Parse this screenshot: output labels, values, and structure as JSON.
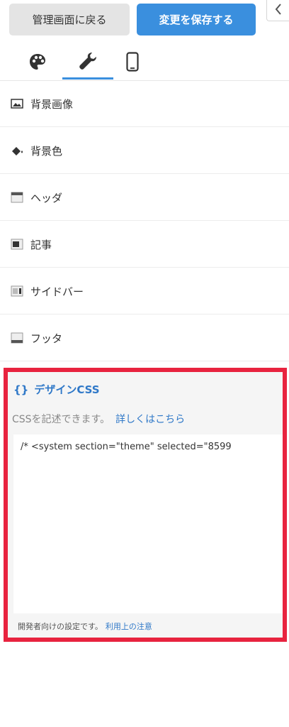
{
  "toolbar": {
    "back_label": "管理画面に戻る",
    "save_label": "変更を保存する"
  },
  "tabs": [
    {
      "name": "theme",
      "icon": "palette-icon",
      "active": false
    },
    {
      "name": "customize",
      "icon": "wrench-icon",
      "active": true
    },
    {
      "name": "mobile",
      "icon": "smartphone-icon",
      "active": false
    }
  ],
  "menu": {
    "items": [
      {
        "label": "背景画像",
        "icon": "image-icon"
      },
      {
        "label": "背景色",
        "icon": "paint-bucket-icon"
      },
      {
        "label": "ヘッダ",
        "icon": "header-layout-icon"
      },
      {
        "label": "記事",
        "icon": "article-layout-icon"
      },
      {
        "label": "サイドバー",
        "icon": "sidebar-layout-icon"
      },
      {
        "label": "フッタ",
        "icon": "footer-layout-icon"
      }
    ]
  },
  "design_css": {
    "title_icon": "{}",
    "title": "デザインCSS",
    "description": "CSSを記述できます。",
    "details_link": "詳しくはこちら",
    "code": "/* <system section=\"theme\" selected=\"8599",
    "footer_text": "開発者向けの設定です。",
    "footer_link": "利用上の注意"
  },
  "colors": {
    "accent": "#3a8fde",
    "highlight_border": "#e8233f",
    "link": "#2f78c8"
  }
}
